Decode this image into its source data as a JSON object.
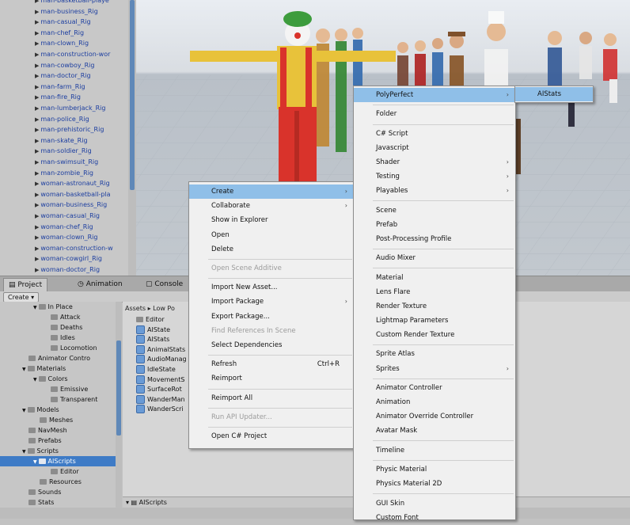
{
  "hierarchy": {
    "items": [
      "man-basketball-playe",
      "man-business_Rig",
      "man-casual_Rig",
      "man-chef_Rig",
      "man-clown_Rig",
      "man-construction-wor",
      "man-cowboy_Rig",
      "man-doctor_Rig",
      "man-farm_Rig",
      "man-fire_Rig",
      "man-lumberjack_Rig",
      "man-police_Rig",
      "man-prehistoric_Rig",
      "man-skate_Rig",
      "man-soldier_Rig",
      "man-swimsuit_Rig",
      "man-zombie_Rig",
      "woman-astronaut_Rig",
      "woman-basketball-pla",
      "woman-business_Rig",
      "woman-casual_Rig",
      "woman-chef_Rig",
      "woman-clown_Rig",
      "woman-construction-w",
      "woman-cowgirl_Rig",
      "woman-doctor_Rig"
    ]
  },
  "tabs": [
    {
      "label": "Project",
      "icon": "folder-icon"
    },
    {
      "label": "Animation",
      "icon": "animation-icon"
    },
    {
      "label": "Console",
      "icon": "console-icon"
    }
  ],
  "toolbar": {
    "create_label": "Create ▾"
  },
  "tree": {
    "nodes": [
      {
        "label": "In Place",
        "depth": 3,
        "expanded": true
      },
      {
        "label": "Attack",
        "depth": 4
      },
      {
        "label": "Deaths",
        "depth": 4
      },
      {
        "label": "Idles",
        "depth": 4
      },
      {
        "label": "Locomotion",
        "depth": 4
      },
      {
        "label": "Animator Contro",
        "depth": 2
      },
      {
        "label": "Materials",
        "depth": 2,
        "expanded": true
      },
      {
        "label": "Colors",
        "depth": 3,
        "expanded": true
      },
      {
        "label": "Emissive",
        "depth": 4
      },
      {
        "label": "Transparent",
        "depth": 4
      },
      {
        "label": "Models",
        "depth": 2,
        "expanded": true
      },
      {
        "label": "Meshes",
        "depth": 3
      },
      {
        "label": "NavMesh",
        "depth": 2
      },
      {
        "label": "Prefabs",
        "depth": 2
      },
      {
        "label": "Scripts",
        "depth": 2,
        "expanded": true
      },
      {
        "label": "AIScripts",
        "depth": 3,
        "expanded": true,
        "selected": true
      },
      {
        "label": "Editor",
        "depth": 4
      },
      {
        "label": "Resources",
        "depth": 3
      },
      {
        "label": "Sounds",
        "depth": 2
      },
      {
        "label": "Stats",
        "depth": 2
      }
    ]
  },
  "assets": {
    "breadcrumb": "Assets ▸ Low Po",
    "items": [
      {
        "label": "Editor",
        "kind": "folder"
      },
      {
        "label": "AIState",
        "kind": "script"
      },
      {
        "label": "AIStats",
        "kind": "script"
      },
      {
        "label": "AnimalStats",
        "kind": "script"
      },
      {
        "label": "AudioManag",
        "kind": "script"
      },
      {
        "label": "IdleState",
        "kind": "script"
      },
      {
        "label": "MovementS",
        "kind": "script"
      },
      {
        "label": "SurfaceRot",
        "kind": "script"
      },
      {
        "label": "WanderMan",
        "kind": "script"
      },
      {
        "label": "WanderScri",
        "kind": "script"
      }
    ],
    "status_path": "AIScripts"
  },
  "context_menu": {
    "items": [
      {
        "label": "Create",
        "submenu": true,
        "highlighted": true
      },
      {
        "label": "Collaborate",
        "submenu": true
      },
      {
        "label": "Show in Explorer"
      },
      {
        "label": "Open"
      },
      {
        "label": "Delete"
      },
      {
        "separator": true
      },
      {
        "label": "Open Scene Additive",
        "disabled": true
      },
      {
        "separator": true
      },
      {
        "label": "Import New Asset..."
      },
      {
        "label": "Import Package",
        "submenu": true
      },
      {
        "label": "Export Package..."
      },
      {
        "label": "Find References In Scene",
        "disabled": true
      },
      {
        "label": "Select Dependencies"
      },
      {
        "separator": true
      },
      {
        "label": "Refresh",
        "shortcut": "Ctrl+R"
      },
      {
        "label": "Reimport"
      },
      {
        "separator": true
      },
      {
        "label": "Reimport All"
      },
      {
        "separator": true
      },
      {
        "label": "Run API Updater...",
        "disabled": true
      },
      {
        "separator": true
      },
      {
        "label": "Open C# Project"
      }
    ]
  },
  "create_menu": {
    "items": [
      {
        "label": "PolyPerfect",
        "submenu": true,
        "highlighted": true
      },
      {
        "separator": true
      },
      {
        "label": "Folder"
      },
      {
        "separator": true
      },
      {
        "label": "C# Script"
      },
      {
        "label": "Javascript"
      },
      {
        "label": "Shader",
        "submenu": true
      },
      {
        "label": "Testing",
        "submenu": true
      },
      {
        "label": "Playables",
        "submenu": true
      },
      {
        "separator": true
      },
      {
        "label": "Scene"
      },
      {
        "label": "Prefab"
      },
      {
        "label": "Post-Processing Profile"
      },
      {
        "separator": true
      },
      {
        "label": "Audio Mixer"
      },
      {
        "separator": true
      },
      {
        "label": "Material"
      },
      {
        "label": "Lens Flare"
      },
      {
        "label": "Render Texture"
      },
      {
        "label": "Lightmap Parameters"
      },
      {
        "label": "Custom Render Texture"
      },
      {
        "separator": true
      },
      {
        "label": "Sprite Atlas"
      },
      {
        "label": "Sprites",
        "submenu": true
      },
      {
        "separator": true
      },
      {
        "label": "Animator Controller"
      },
      {
        "label": "Animation"
      },
      {
        "label": "Animator Override Controller"
      },
      {
        "label": "Avatar Mask"
      },
      {
        "separator": true
      },
      {
        "label": "Timeline"
      },
      {
        "separator": true
      },
      {
        "label": "Physic Material"
      },
      {
        "label": "Physics Material 2D"
      },
      {
        "separator": true
      },
      {
        "label": "GUI Skin"
      },
      {
        "label": "Custom Font"
      }
    ]
  },
  "polyperfect_menu": {
    "items": [
      {
        "label": "AIStats",
        "highlighted": true
      }
    ]
  },
  "colors": {
    "highlight": "#8fbfe8",
    "selection": "#3e7bc6",
    "link_text": "#1c3ea0"
  }
}
